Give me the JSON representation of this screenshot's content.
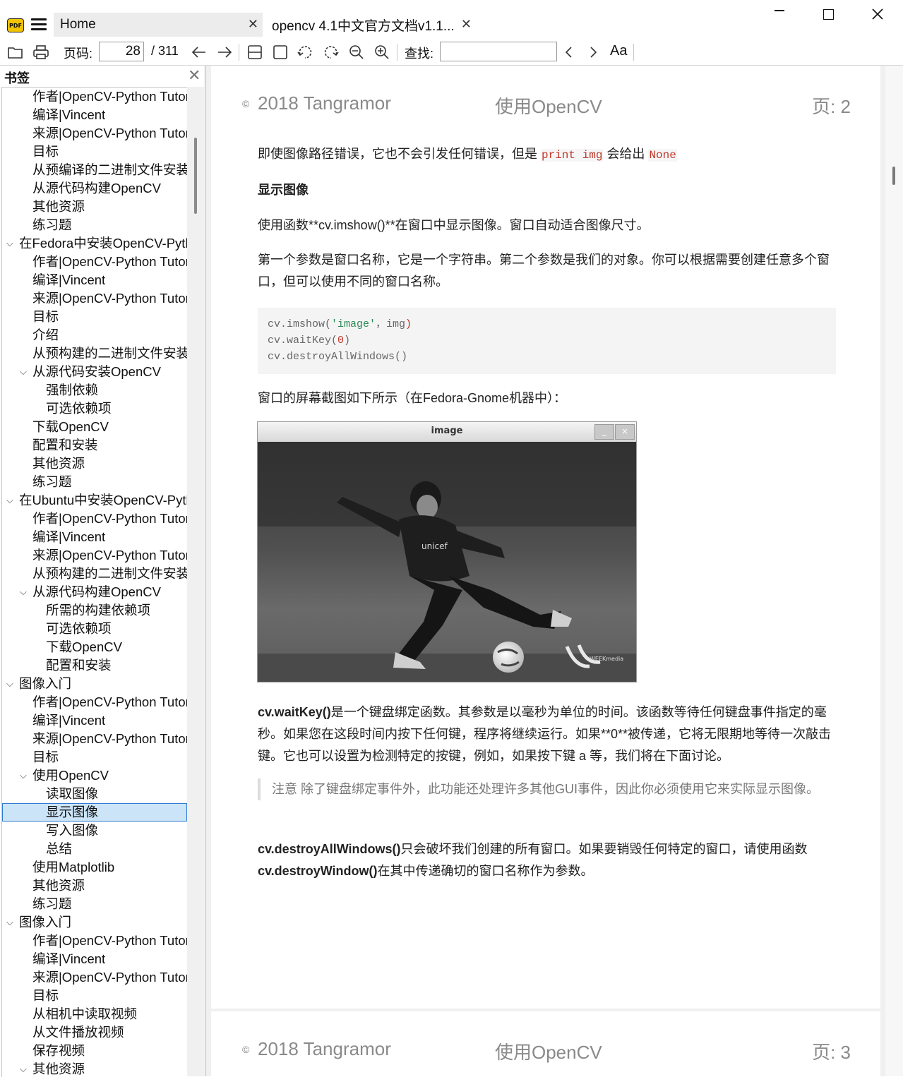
{
  "titlebar": {
    "app_logo": "PDF",
    "tabs": [
      {
        "label": "Home"
      },
      {
        "label": "opencv 4.1中文官方文档v1.1..."
      }
    ],
    "icons": {
      "menu": "hamburger-icon",
      "close": "close-icon",
      "minimize": "minimize-icon",
      "maximize": "maximize-icon"
    }
  },
  "toolbar": {
    "page_label": "页码:",
    "page_value": "28",
    "page_total": "/ 311",
    "search_label": "查找:",
    "search_value": "",
    "font_button": "Aa"
  },
  "sidebar": {
    "title": "书签",
    "items": [
      {
        "label": "作者|OpenCV-Python Tutorials",
        "level": 2
      },
      {
        "label": "编译|Vincent",
        "level": 2
      },
      {
        "label": "来源|OpenCV-Python Tutorials",
        "level": 2
      },
      {
        "label": "目标",
        "level": 2
      },
      {
        "label": "从预编译的二进制文件安装OpenCV-Python",
        "level": 2
      },
      {
        "label": "从源代码构建OpenCV",
        "level": 2
      },
      {
        "label": "其他资源",
        "level": 2
      },
      {
        "label": "练习题",
        "level": 2
      },
      {
        "label": "在Fedora中安装OpenCV-Python",
        "level": 1,
        "expanded": true
      },
      {
        "label": "作者|OpenCV-Python Tutorials",
        "level": 2
      },
      {
        "label": "编译|Vincent",
        "level": 2
      },
      {
        "label": "来源|OpenCV-Python Tutorials",
        "level": 2
      },
      {
        "label": "目标",
        "level": 2
      },
      {
        "label": "介绍",
        "level": 2
      },
      {
        "label": "从预构建的二进制文件安装OpenCV-Python",
        "level": 2
      },
      {
        "label": "从源代码安装OpenCV",
        "level": 2,
        "expanded": true
      },
      {
        "label": "强制依赖",
        "level": 3
      },
      {
        "label": "可选依赖项",
        "level": 3
      },
      {
        "label": "下载OpenCV",
        "level": 2
      },
      {
        "label": "配置和安装",
        "level": 2
      },
      {
        "label": "其他资源",
        "level": 2
      },
      {
        "label": "练习题",
        "level": 2
      },
      {
        "label": "在Ubuntu中安装OpenCV-Python",
        "level": 1,
        "expanded": true
      },
      {
        "label": "作者|OpenCV-Python Tutorials",
        "level": 2
      },
      {
        "label": "编译|Vincent",
        "level": 2
      },
      {
        "label": "来源|OpenCV-Python Tutorials",
        "level": 2
      },
      {
        "label": "从预构建的二进制文件安装OpenCV-Python",
        "level": 2
      },
      {
        "label": "从源代码构建OpenCV",
        "level": 2,
        "expanded": true
      },
      {
        "label": "所需的构建依赖项",
        "level": 3
      },
      {
        "label": "可选依赖项",
        "level": 3
      },
      {
        "label": "下载OpenCV",
        "level": 3
      },
      {
        "label": "配置和安装",
        "level": 3
      },
      {
        "label": "图像入门",
        "level": 1,
        "expanded": true
      },
      {
        "label": "作者|OpenCV-Python Tutorials",
        "level": 2
      },
      {
        "label": "编译|Vincent",
        "level": 2
      },
      {
        "label": "来源|OpenCV-Python Tutorials",
        "level": 2
      },
      {
        "label": "目标",
        "level": 2
      },
      {
        "label": "使用OpenCV",
        "level": 2,
        "expanded": true
      },
      {
        "label": "读取图像",
        "level": 3
      },
      {
        "label": "显示图像",
        "level": 3,
        "selected": true
      },
      {
        "label": "写入图像",
        "level": 3
      },
      {
        "label": "总结",
        "level": 3
      },
      {
        "label": "使用Matplotlib",
        "level": 2
      },
      {
        "label": "其他资源",
        "level": 2
      },
      {
        "label": "练习题",
        "level": 2
      },
      {
        "label": "图像入门",
        "level": 1,
        "expanded": true
      },
      {
        "label": "作者|OpenCV-Python Tutorials",
        "level": 2
      },
      {
        "label": "编译|Vincent",
        "level": 2
      },
      {
        "label": "来源|OpenCV-Python Tutorials",
        "level": 2
      },
      {
        "label": "目标",
        "level": 2
      },
      {
        "label": "从相机中读取视频",
        "level": 2
      },
      {
        "label": "从文件播放视频",
        "level": 2
      },
      {
        "label": "保存视频",
        "level": 2
      },
      {
        "label": "其他资源",
        "level": 2,
        "expanded": true
      }
    ]
  },
  "document": {
    "page_header": {
      "copyright_symbol": "©",
      "left": "2018 Tangramor",
      "middle": "使用OpenCV",
      "right": "页:  2"
    },
    "page_header_next": {
      "copyright_symbol": "©",
      "left": "2018 Tangramor",
      "middle": "使用OpenCV",
      "right": "页:  3"
    },
    "p1": {
      "before": "即使图像路径错误，它也不会引发任何错误，但是 ",
      "code1": "print img",
      "middle": " 会给出 ",
      "code2": "None"
    },
    "heading": "显示图像",
    "p2": "使用函数**cv.imshow()**在窗口中显示图像。窗口自动适合图像尺寸。",
    "p3": "第一个参数是窗口名称，它是一个字符串。第二个参数是我们的对象。你可以根据需要创建任意多个窗口，但可以使用不同的窗口名称。",
    "code": {
      "line1_a": "cv.imshow(",
      "line1_str": "'image'",
      "line1_b": "，img",
      "line1_c": ")",
      "line2_a": "cv.waitKey(",
      "line2_num": "0",
      "line2_b": ")",
      "line3": "cv.destroyAllWindows()"
    },
    "p4": "窗口的屏幕截图如下所示（在Fedora-Gnome机器中）：",
    "figure": {
      "window_title": "image",
      "min_btn": "_",
      "close_btn": "×",
      "shirt_text": "unicef",
      "watermark": "WEEKmedia"
    },
    "p5": {
      "bold": "cv.waitKey()",
      "rest": "是一个键盘绑定函数。其参数是以毫秒为单位的时间。该函数等待任何键盘事件指定的毫秒。如果您在这段时间内按下任何键，程序将继续运行。如果**0**被传递，它将无限期地等待一次敲击键。它也可以设置为检测特定的按键，例如，如果按下键 a 等，我们将在下面讨论。"
    },
    "quote": "注意 除了键盘绑定事件外，此功能还处理许多其他GUI事件，因此你必须使用它来实际显示图像。",
    "p6": {
      "bold1": "cv.destroyAllWindows()",
      "mid": "只会破坏我们创建的所有窗口。如果要销毁任何特定的窗口，请使用函数 ",
      "bold2": "cv.destroyWindow()",
      "rest": "在其中传递确切的窗口名称作为参数。"
    }
  }
}
